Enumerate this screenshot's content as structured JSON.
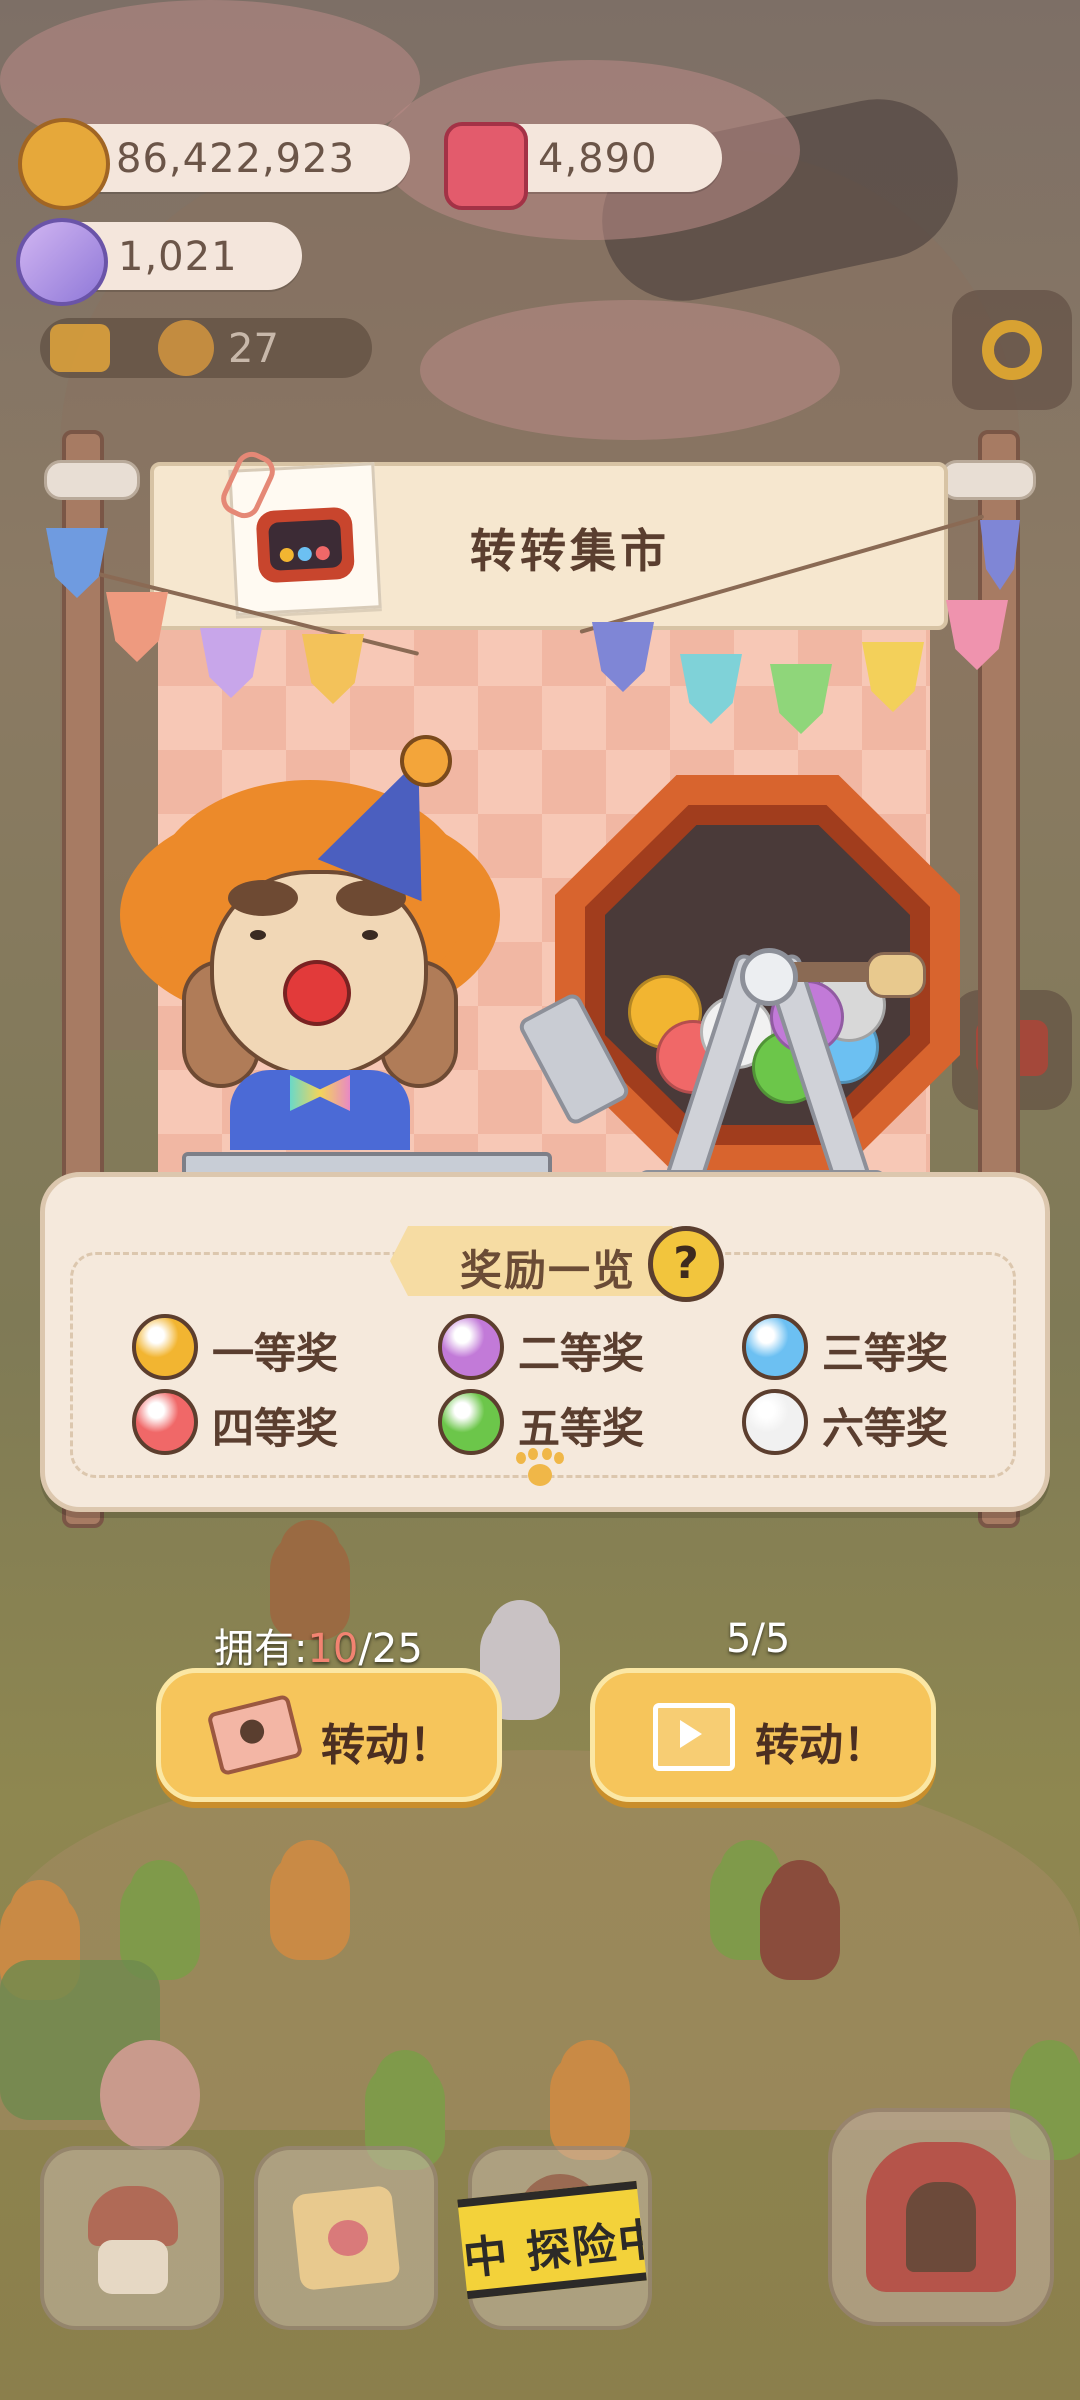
{
  "resources": {
    "coins": "86,422,923",
    "candles": "4,890",
    "candy": "1,021",
    "announcement_count": "27"
  },
  "stall": {
    "title": "转转集市"
  },
  "rewards": {
    "title": "奖励一览",
    "help_symbol": "?",
    "prizes": [
      {
        "label": "一等奖",
        "color": "#f2b531"
      },
      {
        "label": "二等奖",
        "color": "#c27ad8"
      },
      {
        "label": "三等奖",
        "color": "#6cc0f2"
      },
      {
        "label": "四等奖",
        "color": "#f06868"
      },
      {
        "label": "五等奖",
        "color": "#6cc64a"
      },
      {
        "label": "六等奖",
        "color": "#f1f1f1"
      }
    ]
  },
  "spin": {
    "ticket": {
      "count_prefix": "拥有:",
      "count_current": "10",
      "count_total": "/25",
      "button_label": "转动！",
      "icon": "ticket-icon"
    },
    "video": {
      "count_label": "5/5",
      "button_label": "转动！",
      "icon": "video-icon"
    }
  },
  "bottom_nav": {
    "hotel_icon": "hotel-icon",
    "diary_icon": "calendar-heart-icon",
    "explore_label": "中  探险中",
    "stage_icon": "stage-icon"
  },
  "colors": {
    "button_yellow": "#f6c55b",
    "panel_cream": "#f5e9dc",
    "text_brown": "#5a3e2f"
  }
}
